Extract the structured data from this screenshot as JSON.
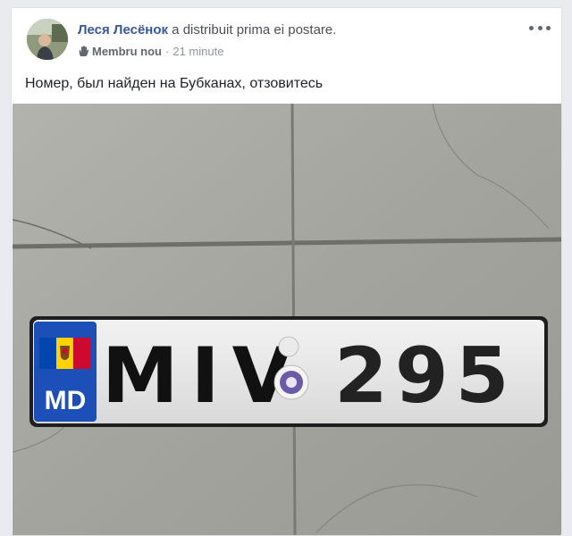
{
  "post": {
    "author": "Леся Лесёнок",
    "action": " a distribuit prima ei postare.",
    "badge": "Membru nou",
    "separator": "·",
    "time": "21 minute",
    "text": "Номер, был найден на Бубканах, отзовитесь"
  },
  "plate": {
    "country_code": "MD",
    "letters": "MIV",
    "digits": "295",
    "band_color": "#1d4fb8",
    "flag_colors": [
      "#0046ae",
      "#ffd200",
      "#cc092f"
    ]
  },
  "icons": {
    "badge": "waving-hand-icon",
    "more": "more-options-icon"
  }
}
